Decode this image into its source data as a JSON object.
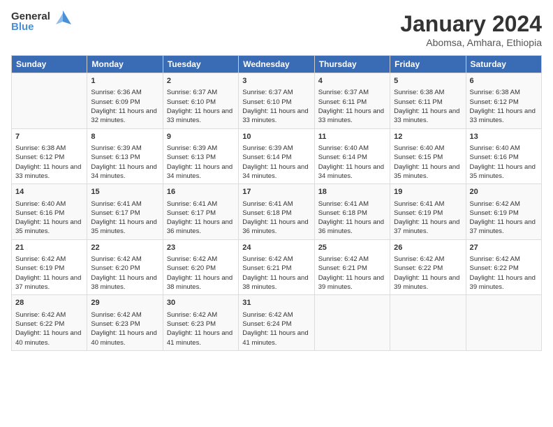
{
  "header": {
    "logo_general": "General",
    "logo_blue": "Blue",
    "month_year": "January 2024",
    "location": "Abomsa, Amhara, Ethiopia"
  },
  "days_of_week": [
    "Sunday",
    "Monday",
    "Tuesday",
    "Wednesday",
    "Thursday",
    "Friday",
    "Saturday"
  ],
  "weeks": [
    [
      {
        "day": "",
        "sunrise": "",
        "sunset": "",
        "daylight": ""
      },
      {
        "day": "1",
        "sunrise": "Sunrise: 6:36 AM",
        "sunset": "Sunset: 6:09 PM",
        "daylight": "Daylight: 11 hours and 32 minutes."
      },
      {
        "day": "2",
        "sunrise": "Sunrise: 6:37 AM",
        "sunset": "Sunset: 6:10 PM",
        "daylight": "Daylight: 11 hours and 33 minutes."
      },
      {
        "day": "3",
        "sunrise": "Sunrise: 6:37 AM",
        "sunset": "Sunset: 6:10 PM",
        "daylight": "Daylight: 11 hours and 33 minutes."
      },
      {
        "day": "4",
        "sunrise": "Sunrise: 6:37 AM",
        "sunset": "Sunset: 6:11 PM",
        "daylight": "Daylight: 11 hours and 33 minutes."
      },
      {
        "day": "5",
        "sunrise": "Sunrise: 6:38 AM",
        "sunset": "Sunset: 6:11 PM",
        "daylight": "Daylight: 11 hours and 33 minutes."
      },
      {
        "day": "6",
        "sunrise": "Sunrise: 6:38 AM",
        "sunset": "Sunset: 6:12 PM",
        "daylight": "Daylight: 11 hours and 33 minutes."
      }
    ],
    [
      {
        "day": "7",
        "sunrise": "Sunrise: 6:38 AM",
        "sunset": "Sunset: 6:12 PM",
        "daylight": "Daylight: 11 hours and 33 minutes."
      },
      {
        "day": "8",
        "sunrise": "Sunrise: 6:39 AM",
        "sunset": "Sunset: 6:13 PM",
        "daylight": "Daylight: 11 hours and 34 minutes."
      },
      {
        "day": "9",
        "sunrise": "Sunrise: 6:39 AM",
        "sunset": "Sunset: 6:13 PM",
        "daylight": "Daylight: 11 hours and 34 minutes."
      },
      {
        "day": "10",
        "sunrise": "Sunrise: 6:39 AM",
        "sunset": "Sunset: 6:14 PM",
        "daylight": "Daylight: 11 hours and 34 minutes."
      },
      {
        "day": "11",
        "sunrise": "Sunrise: 6:40 AM",
        "sunset": "Sunset: 6:14 PM",
        "daylight": "Daylight: 11 hours and 34 minutes."
      },
      {
        "day": "12",
        "sunrise": "Sunrise: 6:40 AM",
        "sunset": "Sunset: 6:15 PM",
        "daylight": "Daylight: 11 hours and 35 minutes."
      },
      {
        "day": "13",
        "sunrise": "Sunrise: 6:40 AM",
        "sunset": "Sunset: 6:16 PM",
        "daylight": "Daylight: 11 hours and 35 minutes."
      }
    ],
    [
      {
        "day": "14",
        "sunrise": "Sunrise: 6:40 AM",
        "sunset": "Sunset: 6:16 PM",
        "daylight": "Daylight: 11 hours and 35 minutes."
      },
      {
        "day": "15",
        "sunrise": "Sunrise: 6:41 AM",
        "sunset": "Sunset: 6:17 PM",
        "daylight": "Daylight: 11 hours and 35 minutes."
      },
      {
        "day": "16",
        "sunrise": "Sunrise: 6:41 AM",
        "sunset": "Sunset: 6:17 PM",
        "daylight": "Daylight: 11 hours and 36 minutes."
      },
      {
        "day": "17",
        "sunrise": "Sunrise: 6:41 AM",
        "sunset": "Sunset: 6:18 PM",
        "daylight": "Daylight: 11 hours and 36 minutes."
      },
      {
        "day": "18",
        "sunrise": "Sunrise: 6:41 AM",
        "sunset": "Sunset: 6:18 PM",
        "daylight": "Daylight: 11 hours and 36 minutes."
      },
      {
        "day": "19",
        "sunrise": "Sunrise: 6:41 AM",
        "sunset": "Sunset: 6:19 PM",
        "daylight": "Daylight: 11 hours and 37 minutes."
      },
      {
        "day": "20",
        "sunrise": "Sunrise: 6:42 AM",
        "sunset": "Sunset: 6:19 PM",
        "daylight": "Daylight: 11 hours and 37 minutes."
      }
    ],
    [
      {
        "day": "21",
        "sunrise": "Sunrise: 6:42 AM",
        "sunset": "Sunset: 6:19 PM",
        "daylight": "Daylight: 11 hours and 37 minutes."
      },
      {
        "day": "22",
        "sunrise": "Sunrise: 6:42 AM",
        "sunset": "Sunset: 6:20 PM",
        "daylight": "Daylight: 11 hours and 38 minutes."
      },
      {
        "day": "23",
        "sunrise": "Sunrise: 6:42 AM",
        "sunset": "Sunset: 6:20 PM",
        "daylight": "Daylight: 11 hours and 38 minutes."
      },
      {
        "day": "24",
        "sunrise": "Sunrise: 6:42 AM",
        "sunset": "Sunset: 6:21 PM",
        "daylight": "Daylight: 11 hours and 38 minutes."
      },
      {
        "day": "25",
        "sunrise": "Sunrise: 6:42 AM",
        "sunset": "Sunset: 6:21 PM",
        "daylight": "Daylight: 11 hours and 39 minutes."
      },
      {
        "day": "26",
        "sunrise": "Sunrise: 6:42 AM",
        "sunset": "Sunset: 6:22 PM",
        "daylight": "Daylight: 11 hours and 39 minutes."
      },
      {
        "day": "27",
        "sunrise": "Sunrise: 6:42 AM",
        "sunset": "Sunset: 6:22 PM",
        "daylight": "Daylight: 11 hours and 39 minutes."
      }
    ],
    [
      {
        "day": "28",
        "sunrise": "Sunrise: 6:42 AM",
        "sunset": "Sunset: 6:22 PM",
        "daylight": "Daylight: 11 hours and 40 minutes."
      },
      {
        "day": "29",
        "sunrise": "Sunrise: 6:42 AM",
        "sunset": "Sunset: 6:23 PM",
        "daylight": "Daylight: 11 hours and 40 minutes."
      },
      {
        "day": "30",
        "sunrise": "Sunrise: 6:42 AM",
        "sunset": "Sunset: 6:23 PM",
        "daylight": "Daylight: 11 hours and 41 minutes."
      },
      {
        "day": "31",
        "sunrise": "Sunrise: 6:42 AM",
        "sunset": "Sunset: 6:24 PM",
        "daylight": "Daylight: 11 hours and 41 minutes."
      },
      {
        "day": "",
        "sunrise": "",
        "sunset": "",
        "daylight": ""
      },
      {
        "day": "",
        "sunrise": "",
        "sunset": "",
        "daylight": ""
      },
      {
        "day": "",
        "sunrise": "",
        "sunset": "",
        "daylight": ""
      }
    ]
  ]
}
